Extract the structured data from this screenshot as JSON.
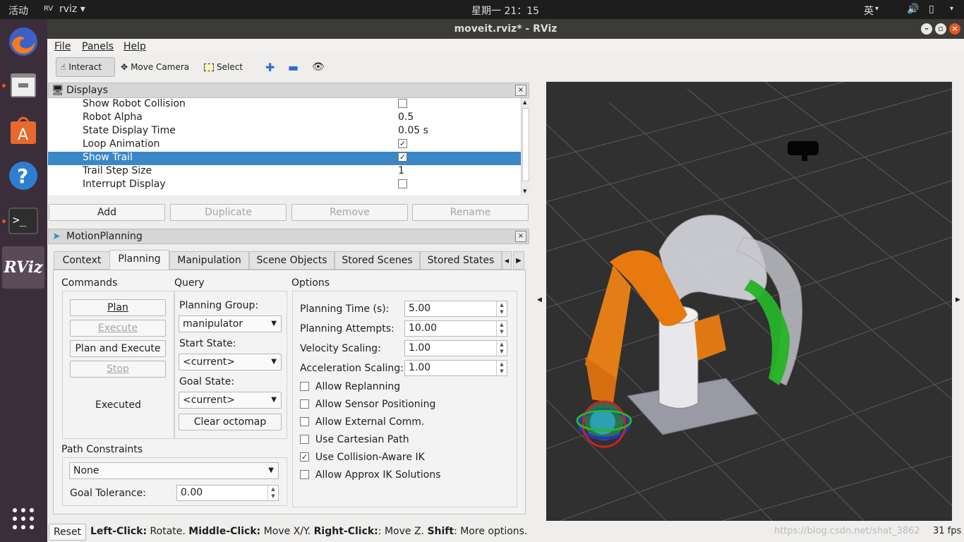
{
  "system": {
    "activities": "活动",
    "app_menu": "rviz",
    "clock": "星期一 21：15",
    "input_method": "英"
  },
  "window": {
    "title": "moveit.rviz* - RViz"
  },
  "menu": {
    "file": "File",
    "panels": "Panels",
    "help": "Help"
  },
  "toolbar": {
    "interact": "Interact",
    "move_camera": "Move Camera",
    "select": "Select"
  },
  "displays": {
    "title": "Displays",
    "rows": [
      {
        "name": "Show Robot Collision",
        "value": "",
        "checkbox": "unchecked"
      },
      {
        "name": "Robot Alpha",
        "value": "0.5"
      },
      {
        "name": "State Display Time",
        "value": "0.05 s"
      },
      {
        "name": "Loop Animation",
        "value": "",
        "checkbox": "checked"
      },
      {
        "name": "Show Trail",
        "value": "",
        "checkbox": "checked",
        "selected": true
      },
      {
        "name": "Trail Step Size",
        "value": "1"
      },
      {
        "name": "Interrupt Display",
        "value": "",
        "checkbox": "unchecked"
      }
    ],
    "buttons": {
      "add": "Add",
      "duplicate": "Duplicate",
      "remove": "Remove",
      "rename": "Rename"
    }
  },
  "motion": {
    "title": "MotionPlanning",
    "tabs": [
      "Context",
      "Planning",
      "Manipulation",
      "Scene Objects",
      "Stored Scenes",
      "Stored States"
    ],
    "active_tab": "Planning",
    "commands": {
      "header": "Commands",
      "plan": "Plan",
      "execute": "Execute",
      "plan_execute": "Plan and Execute",
      "stop": "Stop",
      "status": "Executed"
    },
    "query": {
      "header": "Query",
      "group_label": "Planning Group:",
      "group": "manipulator",
      "start_label": "Start State:",
      "start": "<current>",
      "goal_label": "Goal State:",
      "goal": "<current>",
      "clear": "Clear octomap"
    },
    "options": {
      "header": "Options",
      "time_label": "Planning Time (s):",
      "time": "5.00",
      "attempts_label": "Planning Attempts:",
      "attempts": "10.00",
      "vel_label": "Velocity Scaling:",
      "vel": "1.00",
      "acc_label": "Acceleration Scaling:",
      "acc": "1.00",
      "checks": [
        {
          "label": "Allow Replanning",
          "checked": false
        },
        {
          "label": "Allow Sensor Positioning",
          "checked": false
        },
        {
          "label": "Allow External Comm.",
          "checked": false
        },
        {
          "label": "Use Cartesian Path",
          "checked": false
        },
        {
          "label": "Use Collision-Aware IK",
          "checked": true
        },
        {
          "label": "Allow Approx IK Solutions",
          "checked": false
        }
      ]
    },
    "path": {
      "header": "Path Constraints",
      "value": "None",
      "tol_label": "Goal Tolerance:",
      "tol": "0.00"
    }
  },
  "status": {
    "reset": "Reset",
    "lc": "Left-Click:",
    "lc_t": " Rotate. ",
    "mc": "Middle-Click:",
    "mc_t": " Move X/Y. ",
    "rc": "Right-Click:",
    "rc_t": ": Move Z. ",
    "sh": "Shift",
    "sh_t": ": More options.",
    "fps": "31 fps",
    "watermark": "https://blog.csdn.net/shat_3862"
  },
  "colors": {
    "selection": "#3a87c8",
    "accent": "#e95420",
    "launcher": "#3b2e3a"
  }
}
